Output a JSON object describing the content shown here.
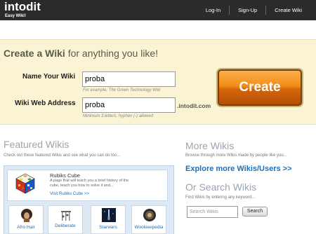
{
  "header": {
    "logo_text": "intodit",
    "logo_tagline": "Easy Wiki!",
    "nav": [
      "Log-In",
      "Sign-Up",
      "Create Wiki"
    ]
  },
  "create": {
    "title_strong": "Create a Wiki",
    "title_rest": " for anything you like!",
    "name_label": "Name Your Wiki",
    "name_value": "proba",
    "name_hint": "For example, The Green Technology Wiki",
    "address_label": "Wiki Web Address",
    "address_value": "proba",
    "address_suffix": ".intodit.com",
    "address_hint": "Minimum 3 letters, hyphen (-) allowed",
    "button_label": "Create"
  },
  "featured": {
    "title": "Featured Wikis",
    "subtitle": "Check out these featured Wikis and see what you can do too...",
    "card": {
      "name": "Rubiks Cube",
      "description": "A page that will teach you a brief history of the cube, teach you how to solve it and...",
      "link": "Visit Rubiks Cube >>",
      "icon": "rubiks-cube-icon"
    },
    "thumbs": [
      {
        "label": "Afro Hair",
        "icon": "afro-hair-icon"
      },
      {
        "label": "Deliberate",
        "icon": "deliberate-icon"
      },
      {
        "label": "Starwars",
        "icon": "starwars-icon"
      },
      {
        "label": "Wookieepedia",
        "icon": "wookieepedia-icon"
      }
    ]
  },
  "more": {
    "title": "More Wikis",
    "subtitle": "Browse through more Wikis made by people like you...",
    "explore_link": "Explore more Wikis/Users >>"
  },
  "search": {
    "title": "Or Search Wikis",
    "subtitle": "Find Wikis by entering any keyword...",
    "placeholder": "Search Wikis",
    "button_label": "Search"
  },
  "colors": {
    "topbar": "#2b2b2b",
    "band": "#fbf4d4",
    "accent_orange": "#f28d18",
    "link_blue": "#1d6fb6",
    "section_gray": "#9aa5b0"
  }
}
